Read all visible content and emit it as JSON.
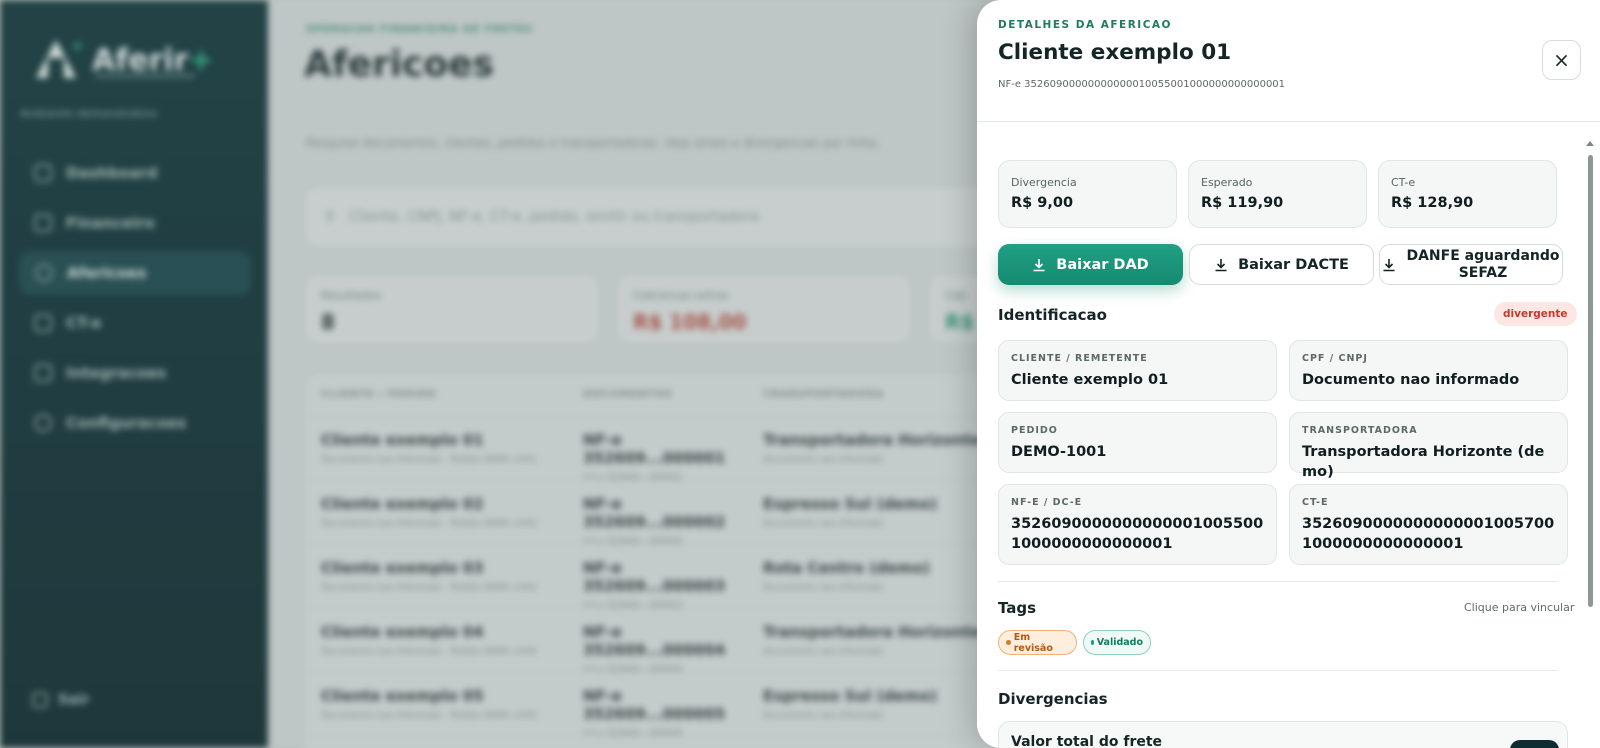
{
  "background": {
    "sidebar": {
      "brand": "Aferir",
      "brand_plus": "+",
      "environment": "Ambiente demonstrativo",
      "items": [
        {
          "label": "Dashboard"
        },
        {
          "label": "Financeiro"
        },
        {
          "label": "Afericoes"
        },
        {
          "label": "CT-e"
        },
        {
          "label": "Integracoes"
        },
        {
          "label": "Configuracoes"
        }
      ],
      "logout": "Sair"
    },
    "main": {
      "breadcrumb": "OPERACAO FINANCEIRA DE FRETES",
      "title": "Afericoes",
      "description": "Pesquise documentos, clientes, pedidos e transportadoras. Veja sinais e divergencias por linha.",
      "search_placeholder": "Cliente, CNPJ, NF-e, CT-e, pedido, emitir ou transportadora",
      "cards": [
        {
          "label": "Resultados",
          "value": "8"
        },
        {
          "label": "Cobrancas extras",
          "value": "R$ 108,00"
        },
        {
          "label": "Cob",
          "value": "R$"
        }
      ],
      "table_headers": [
        "CLIENTE / PEDIDO",
        "DOCUMENTOS",
        "TRANSPORTADORA"
      ],
      "rows": [
        {
          "client": "Cliente exemplo 01",
          "client_sub": "Documento nao informado · Pedido DEMO-1001",
          "doc": "NF-e 352609...000001",
          "doc_sub": "CT-e 352609...000001",
          "carrier": "Transportadora Horizonte (de",
          "carrier_sub": "Documento nao informado"
        },
        {
          "client": "Cliente exemplo 02",
          "client_sub": "Documento nao informado · Pedido DEMO-1002",
          "doc": "NF-e 352609...000002",
          "doc_sub": "CT-e 352609...000002",
          "carrier": "Expresso Sul (demo)",
          "carrier_sub": "Documento nao informado"
        },
        {
          "client": "Cliente exemplo 03",
          "client_sub": "Documento nao informado · Pedido DEMO-1003",
          "doc": "NF-e 352609...000003",
          "doc_sub": "CT-e 352609...000003",
          "carrier": "Rota Centro (demo)",
          "carrier_sub": "Documento nao informado"
        },
        {
          "client": "Cliente exemplo 04",
          "client_sub": "Documento nao informado · Pedido DEMO-1004",
          "doc": "NF-e 352609...000004",
          "doc_sub": "CT-e 352609...000004",
          "carrier": "Transportadora Horizonte (de",
          "carrier_sub": "Documento nao informado"
        },
        {
          "client": "Cliente exemplo 05",
          "client_sub": "Documento nao informado · Pedido DEMO-1005",
          "doc": "NF-e 352609...000005",
          "doc_sub": "CT-e 352609...000005",
          "carrier": "Expresso Sul (demo)",
          "carrier_sub": "Documento nao informado"
        }
      ]
    }
  },
  "drawer": {
    "eyebrow": "DETALHES DA AFERICAO",
    "title": "Cliente exemplo 01",
    "subtitle": "NF-e 35260900000000000010055001000000000000001",
    "close_label": "×",
    "metrics": [
      {
        "label": "Divergencia",
        "value": "R$ 9,00"
      },
      {
        "label": "Esperado",
        "value": "R$ 119,90"
      },
      {
        "label": "CT-e",
        "value": "R$ 128,90"
      }
    ],
    "actions": {
      "download_dad": "Baixar DAD",
      "download_dacte": "Baixar DACTE",
      "danfe_line1": "DANFE aguardando",
      "danfe_line2": "SEFAZ"
    },
    "identification": {
      "title": "Identificacao",
      "status_badge": "divergente",
      "fields": [
        {
          "key": "CLIENTE / REMETENTE",
          "value": "Cliente exemplo 01"
        },
        {
          "key": "CPF / CNPJ",
          "value": "Documento nao informado"
        },
        {
          "key": "PEDIDO",
          "value": "DEMO-1001"
        },
        {
          "key": "TRANSPORTADORA",
          "value": "Transportadora Horizonte (demo)"
        },
        {
          "key": "NF-E / DC-E",
          "value": "35260900000000000010055001000000000000001"
        },
        {
          "key": "CT-E",
          "value": "35260900000000000010057001000000000000001"
        }
      ]
    },
    "tags": {
      "title": "Tags",
      "hint": "Clique para vincular",
      "items": [
        {
          "label": "Em revisão",
          "color": "#d77b26"
        },
        {
          "label": "Validado",
          "color": "#1e9a77"
        }
      ]
    },
    "divergences": {
      "title": "Divergencias",
      "first_item": "Valor total do frete"
    }
  },
  "colors": {
    "accent": "#158a70",
    "sidebar_bg": "#0d3337",
    "danger": "#c23a2c"
  }
}
